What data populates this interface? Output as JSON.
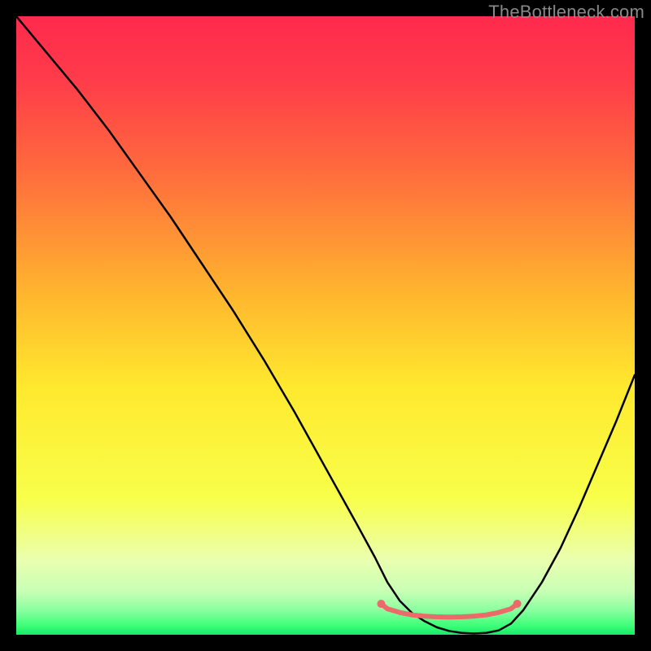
{
  "watermark": "TheBottleneck.com",
  "chart_data": {
    "type": "line",
    "title": "",
    "xlabel": "",
    "ylabel": "",
    "xlim": [
      0,
      100
    ],
    "ylim": [
      0,
      100
    ],
    "gradient_stops": [
      {
        "offset": 0.0,
        "color": "#ff2a4d"
      },
      {
        "offset": 0.1,
        "color": "#ff3b4a"
      },
      {
        "offset": 0.25,
        "color": "#ff6b3d"
      },
      {
        "offset": 0.45,
        "color": "#ffb62e"
      },
      {
        "offset": 0.6,
        "color": "#ffe92e"
      },
      {
        "offset": 0.78,
        "color": "#f8ff4a"
      },
      {
        "offset": 0.88,
        "color": "#eaffb0"
      },
      {
        "offset": 0.93,
        "color": "#c7ffb5"
      },
      {
        "offset": 0.96,
        "color": "#8bffa0"
      },
      {
        "offset": 0.985,
        "color": "#3eff78"
      },
      {
        "offset": 1.0,
        "color": "#17e86a"
      }
    ],
    "series": [
      {
        "name": "curve",
        "x": [
          0,
          5,
          10,
          15,
          20,
          25,
          30,
          35,
          40,
          45,
          50,
          55,
          58,
          60,
          62,
          64,
          66,
          68,
          70,
          72,
          74,
          76,
          78,
          80,
          82,
          85,
          88,
          91,
          94,
          97,
          100
        ],
        "y": [
          100,
          94,
          88,
          81.5,
          74.5,
          67.5,
          60,
          52.5,
          44.5,
          36,
          27,
          18,
          12.5,
          8.5,
          5.5,
          3.5,
          2.2,
          1.2,
          0.6,
          0.3,
          0.2,
          0.3,
          0.7,
          1.8,
          4,
          8.5,
          14,
          20.5,
          27.5,
          34.5,
          42
        ]
      },
      {
        "name": "bottom-marker",
        "x": [
          59,
          60,
          62,
          64,
          66,
          68,
          70,
          72,
          74,
          76,
          78,
          80,
          81
        ],
        "y": [
          5.0,
          4.2,
          3.6,
          3.2,
          3.0,
          2.9,
          2.85,
          2.9,
          3.0,
          3.2,
          3.6,
          4.2,
          5.0
        ]
      }
    ],
    "marker_style": {
      "color": "#ed6a6a",
      "stroke_width": 6,
      "endpoint_radius": 5
    }
  }
}
